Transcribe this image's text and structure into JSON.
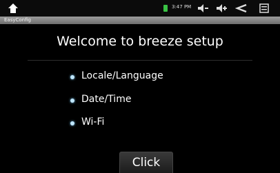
{
  "status_bar": {
    "time": "3:47 PM",
    "icons": [
      "home-icon",
      "battery-icon",
      "volume-down-icon",
      "volume-up-icon",
      "back-icon",
      "menu-icon"
    ],
    "battery_color": "#39c244"
  },
  "window": {
    "title": "EasyConfig"
  },
  "main": {
    "heading": "Welcome to breeze setup",
    "items": [
      {
        "label": "Locale/Language"
      },
      {
        "label": "Date/Time"
      },
      {
        "label": "Wi-Fi"
      }
    ],
    "click_label": "Click"
  }
}
